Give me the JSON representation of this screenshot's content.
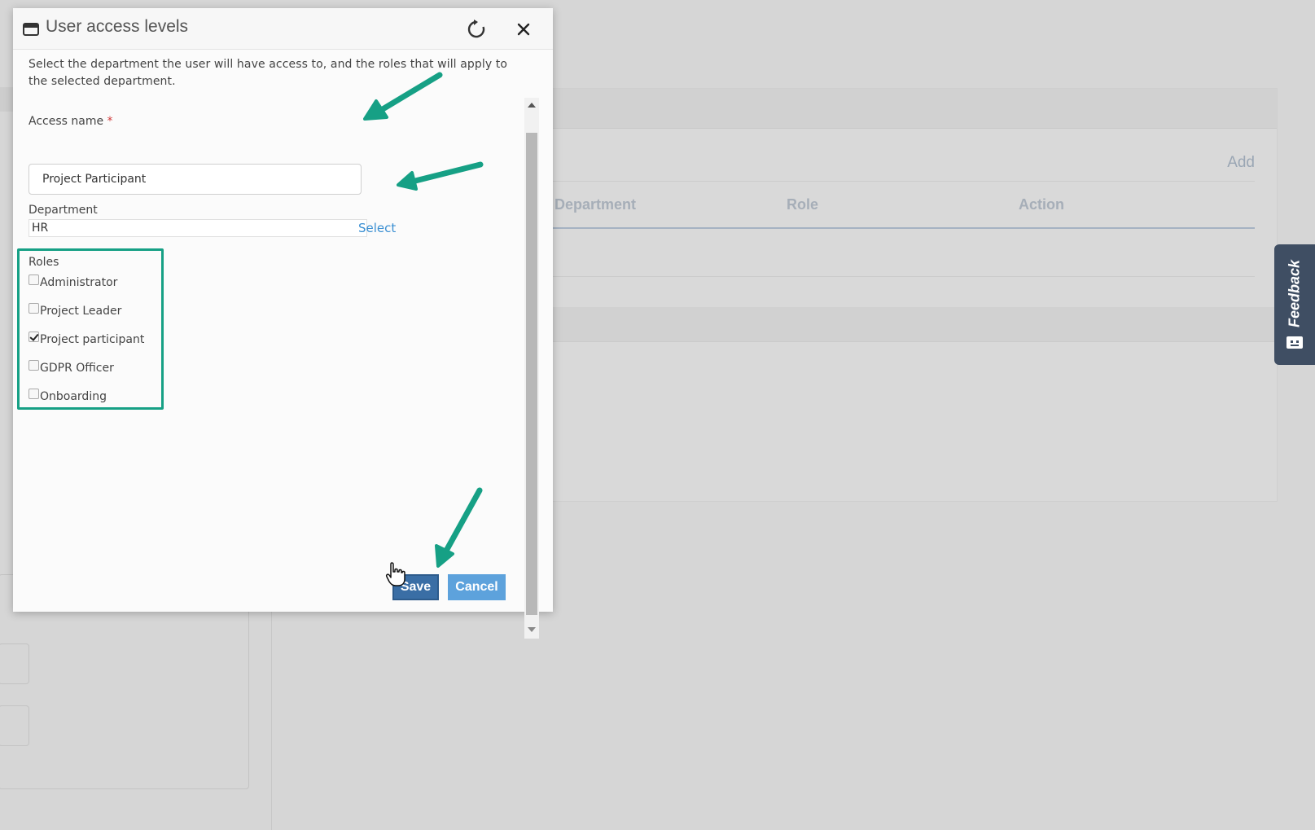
{
  "modal": {
    "title": "User access levels",
    "intro": "Select the department the user will have access to, and the roles that will apply to the selected department.",
    "access_name": {
      "label": "Access name",
      "required_mark": "*",
      "value": "Project Participant"
    },
    "department": {
      "label": "Department",
      "value": "HR",
      "select_label": "Select"
    },
    "roles": {
      "label": "Roles",
      "items": [
        {
          "label": "Administrator",
          "checked": false
        },
        {
          "label": "Project Leader",
          "checked": false
        },
        {
          "label": "Project participant",
          "checked": true
        },
        {
          "label": "GDPR Officer",
          "checked": false
        },
        {
          "label": "Onboarding",
          "checked": false
        }
      ]
    },
    "buttons": {
      "save": "Save",
      "cancel": "Cancel"
    }
  },
  "background": {
    "add_label": "Add",
    "table_headers": [
      "Department",
      "Role",
      "Action"
    ]
  },
  "feedback": {
    "label": "Feedback"
  },
  "colors": {
    "annotation": "#16a085",
    "link": "#3a8fd2",
    "save": "#3a6ea5",
    "cancel": "#5da2dc",
    "feedback_bg": "#3f4e63"
  }
}
